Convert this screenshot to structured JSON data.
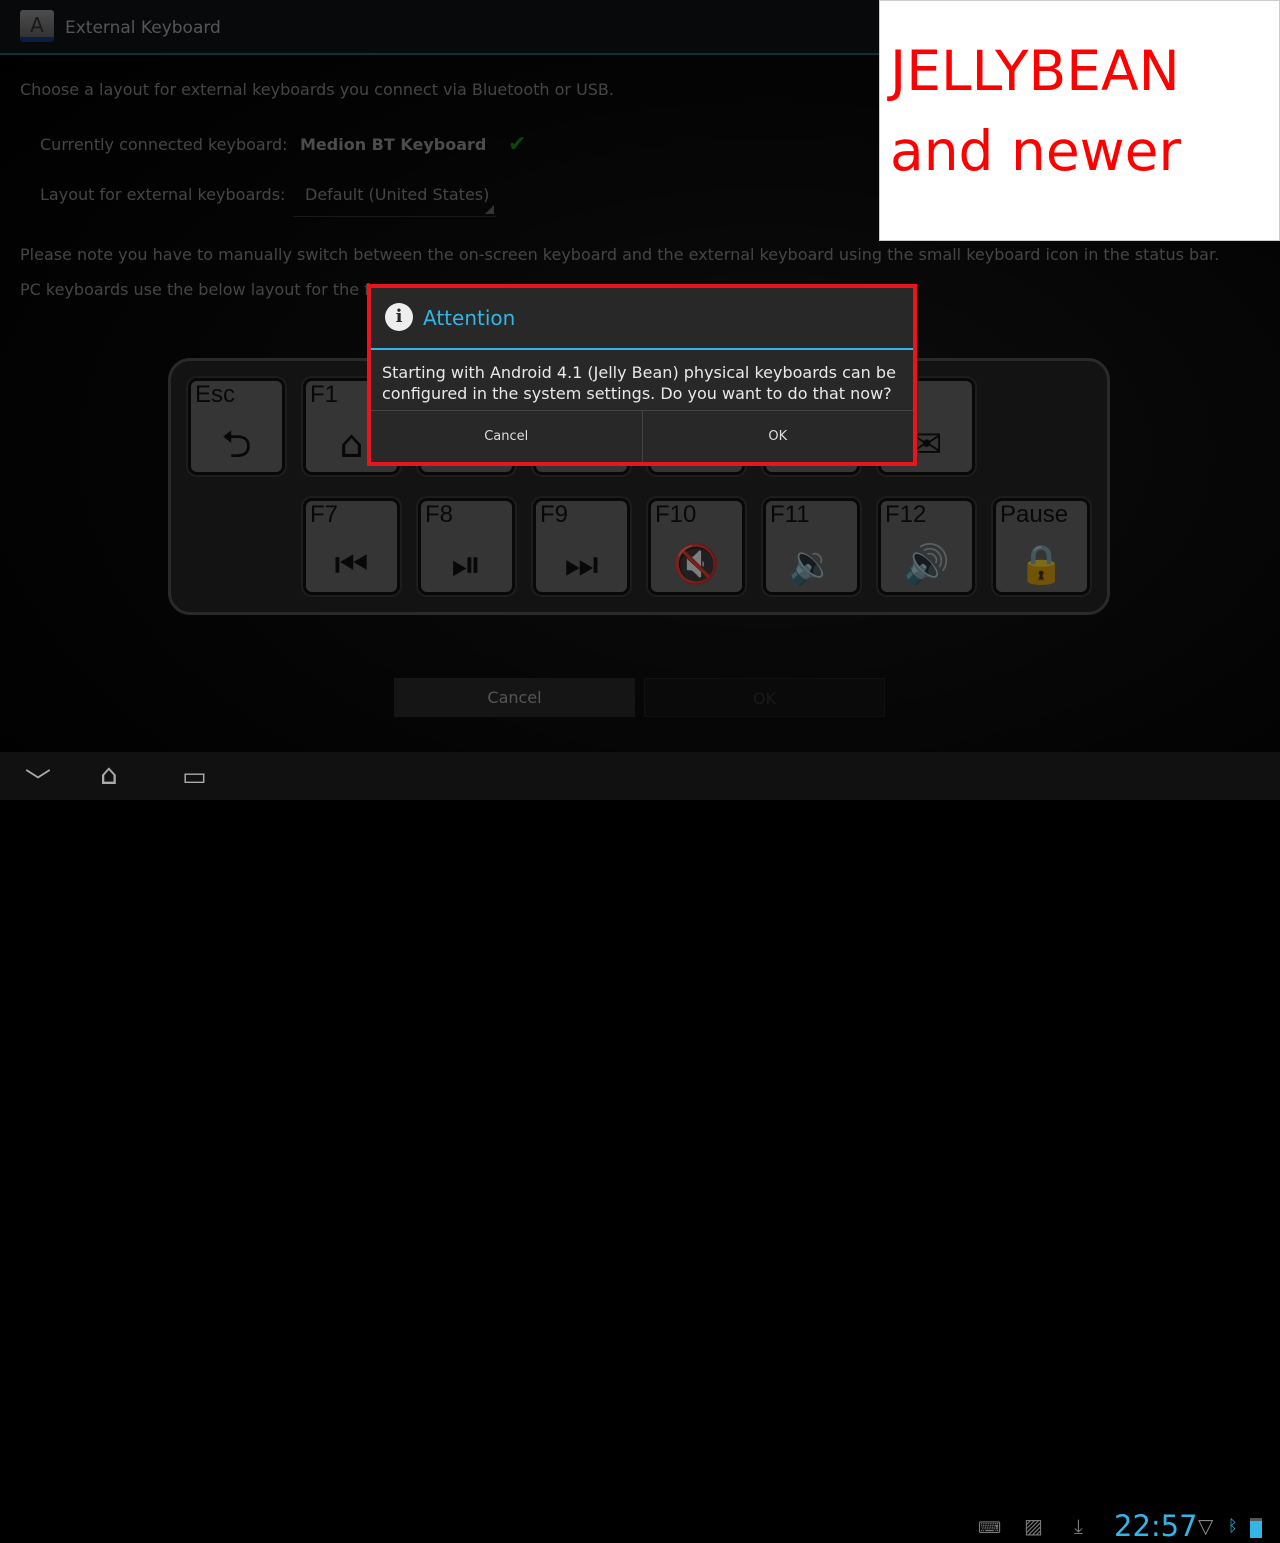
{
  "app": {
    "title": "External Keyboard",
    "icon_letter": "A",
    "icon": "keyboard-key-icon"
  },
  "content": {
    "intro": "Choose a layout for external keyboards you connect via Bluetooth or USB.",
    "connected_label": "Currently connected keyboard:",
    "connected_value": "Medion BT Keyboard",
    "connected_status_icon": "checkmark-icon",
    "layout_label": "Layout for external keyboards:",
    "layout_value": "Default (United States)",
    "note1": "Please note you have to manually switch between the on-screen keyboard and the external keyboard using the small keyboard icon in the status bar.",
    "note2": "PC keyboards use the below layout for the fu"
  },
  "keys_row1": [
    {
      "label": "Esc",
      "icon": "back-icon"
    },
    {
      "label": "F1",
      "icon": "home-icon"
    },
    {
      "label": "",
      "icon": ""
    },
    {
      "label": "",
      "icon": ""
    },
    {
      "label": "",
      "icon": ""
    },
    {
      "label": "",
      "icon": ""
    },
    {
      "label": "",
      "icon": "envelope-icon"
    }
  ],
  "keys_row2": [
    {
      "label": "F7",
      "icon": "previous-track-icon"
    },
    {
      "label": "F8",
      "icon": "play-pause-icon"
    },
    {
      "label": "F9",
      "icon": "next-track-icon"
    },
    {
      "label": "F10",
      "icon": "mute-icon"
    },
    {
      "label": "F11",
      "icon": "volume-down-icon"
    },
    {
      "label": "F12",
      "icon": "volume-up-icon"
    },
    {
      "label": "Pause",
      "icon": "lock-icon"
    }
  ],
  "dialog": {
    "title": "Attention",
    "message": "Starting with Android 4.1 (Jelly Bean) physical keyboards can be configured in the system settings. Do you want to do that now?",
    "cancel": "Cancel",
    "ok": "OK"
  },
  "buttons": {
    "cancel": "Cancel",
    "ok": "OK"
  },
  "banner": {
    "line1": "JELLYBEAN",
    "line2": "and newer"
  },
  "statusbar": {
    "time": "22:57",
    "accent": "#33b5e5"
  },
  "colors": {
    "highlight": "#e8141e",
    "accent": "#33b5e5"
  }
}
